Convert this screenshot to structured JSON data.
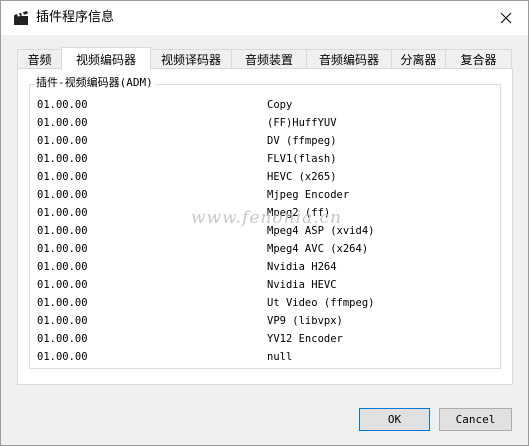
{
  "window": {
    "title": "插件程序信息",
    "app_icon": "clapperboard-icon",
    "close_icon": "close-icon"
  },
  "tabs": [
    {
      "label": "音频",
      "active": false
    },
    {
      "label": "视频编码器",
      "active": true
    },
    {
      "label": "视频译码器",
      "active": false
    },
    {
      "label": "音频装置",
      "active": false
    },
    {
      "label": "音频编码器",
      "active": false
    },
    {
      "label": "分离器",
      "active": false
    },
    {
      "label": "复合器",
      "active": false
    }
  ],
  "group": {
    "title": "插件-视频编码器(ADM)",
    "rows": [
      {
        "version": "01.00.00",
        "name": "Copy"
      },
      {
        "version": "01.00.00",
        "name": "(FF)HuffYUV"
      },
      {
        "version": "01.00.00",
        "name": "DV (ffmpeg)"
      },
      {
        "version": "01.00.00",
        "name": "FLV1(flash)"
      },
      {
        "version": "01.00.00",
        "name": "HEVC (x265)"
      },
      {
        "version": "01.00.00",
        "name": "Mjpeg Encoder"
      },
      {
        "version": "01.00.00",
        "name": "Mpeg2 (ff)"
      },
      {
        "version": "01.00.00",
        "name": "Mpeg4 ASP (xvid4)"
      },
      {
        "version": "01.00.00",
        "name": "Mpeg4 AVC (x264)"
      },
      {
        "version": "01.00.00",
        "name": "Nvidia H264"
      },
      {
        "version": "01.00.00",
        "name": "Nvidia HEVC"
      },
      {
        "version": "01.00.00",
        "name": "Ut Video (ffmpeg)"
      },
      {
        "version": "01.00.00",
        "name": "VP9 (libvpx)"
      },
      {
        "version": "01.00.00",
        "name": "YV12 Encoder"
      },
      {
        "version": "01.00.00",
        "name": "null"
      }
    ]
  },
  "watermark": "www.fenonia.cn",
  "buttons": {
    "ok": "OK",
    "cancel": "Cancel"
  },
  "colors": {
    "accent_border": "#0078d7",
    "button_bg": "#e1e1e1",
    "dialog_bg": "#f0f0f0"
  }
}
